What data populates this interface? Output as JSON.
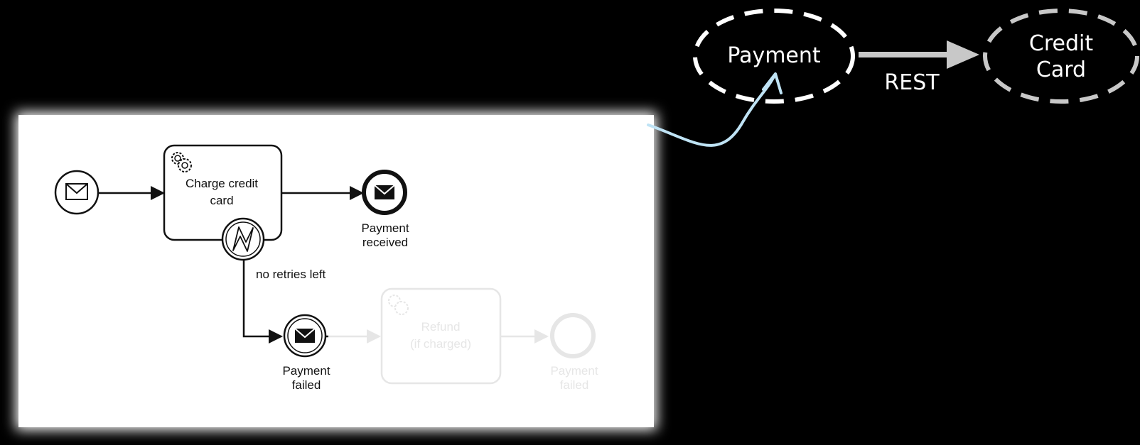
{
  "services": {
    "payment": {
      "label": "Payment"
    },
    "credit_card": {
      "line1": "Credit",
      "line2": "Card"
    },
    "connection_label": "REST"
  },
  "process": {
    "task_charge": {
      "line1": "Charge credit",
      "line2": "card"
    },
    "end_received": {
      "line1": "Payment",
      "line2": "received"
    },
    "boundary_label": "no retries left",
    "throw_failed": {
      "line1": "Payment",
      "line2": "failed"
    },
    "task_refund": {
      "line1": "Refund",
      "line2": "(if charged)"
    },
    "end_failed": {
      "line1": "Payment",
      "line2": "failed"
    }
  },
  "colors": {
    "background": "#000000",
    "canvas": "#ffffff",
    "stroke": "#111111",
    "faded": "#e6e6e6",
    "service_border": "#ffffff",
    "credit_card_border": "#c8c8c8",
    "rest_arrow": "#c8c8c8",
    "link_curve": "#bfe3f5"
  }
}
